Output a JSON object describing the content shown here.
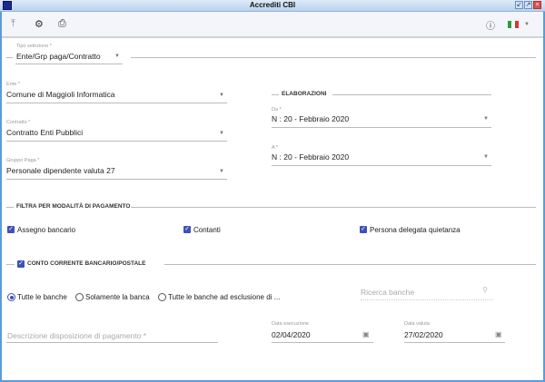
{
  "window": {
    "title": "Accrediti CBI"
  },
  "toolbar": {
    "icons": [
      "upload-icon",
      "gear-icon",
      "print-icon",
      "help-icon",
      "italy-flag-icon"
    ]
  },
  "tipo_selezione": {
    "label": "Tipo selezione *",
    "value": "Ente/Grp paga/Contratto"
  },
  "ente": {
    "label": "Ente *",
    "value": "Comune di Maggioli Informatica"
  },
  "contratto": {
    "label": "Contratto *",
    "value": "Contratto Enti Pubblici"
  },
  "gruppo_paga": {
    "label": "Gruppo Paga *",
    "value": "Personale dipendente valuta 27"
  },
  "elaborazioni": {
    "title": "ELABORAZIONI",
    "da": {
      "label": "Da *",
      "value": "N : 20 - Febbraio 2020"
    },
    "a": {
      "label": "A *",
      "value": "N : 20 - Febbraio 2020"
    }
  },
  "filtra": {
    "title": "FILTRA PER MODALITÀ DI PAGAMENTO",
    "options": [
      {
        "label": "Assegno bancario",
        "checked": true
      },
      {
        "label": "Contanti",
        "checked": true
      },
      {
        "label": "Persona delegata quietanza",
        "checked": true
      }
    ]
  },
  "conto": {
    "title": "CONTO CORRENTE BANCARIO/POSTALE",
    "checked": true,
    "radios": [
      {
        "label": "Tutte le banche",
        "selected": true
      },
      {
        "label": "Solamente la banca",
        "selected": false
      },
      {
        "label": "Tutte le banche ad esclusione di ...",
        "selected": false
      }
    ],
    "search_placeholder": "Ricerca banche"
  },
  "descrizione": {
    "placeholder": "Descrizione disposizione di pagamento *"
  },
  "data_esecuzione": {
    "label": "Data esecuzione",
    "value": "02/04/2020"
  },
  "data_valuta": {
    "label": "Data valuta",
    "value": "27/02/2020"
  }
}
